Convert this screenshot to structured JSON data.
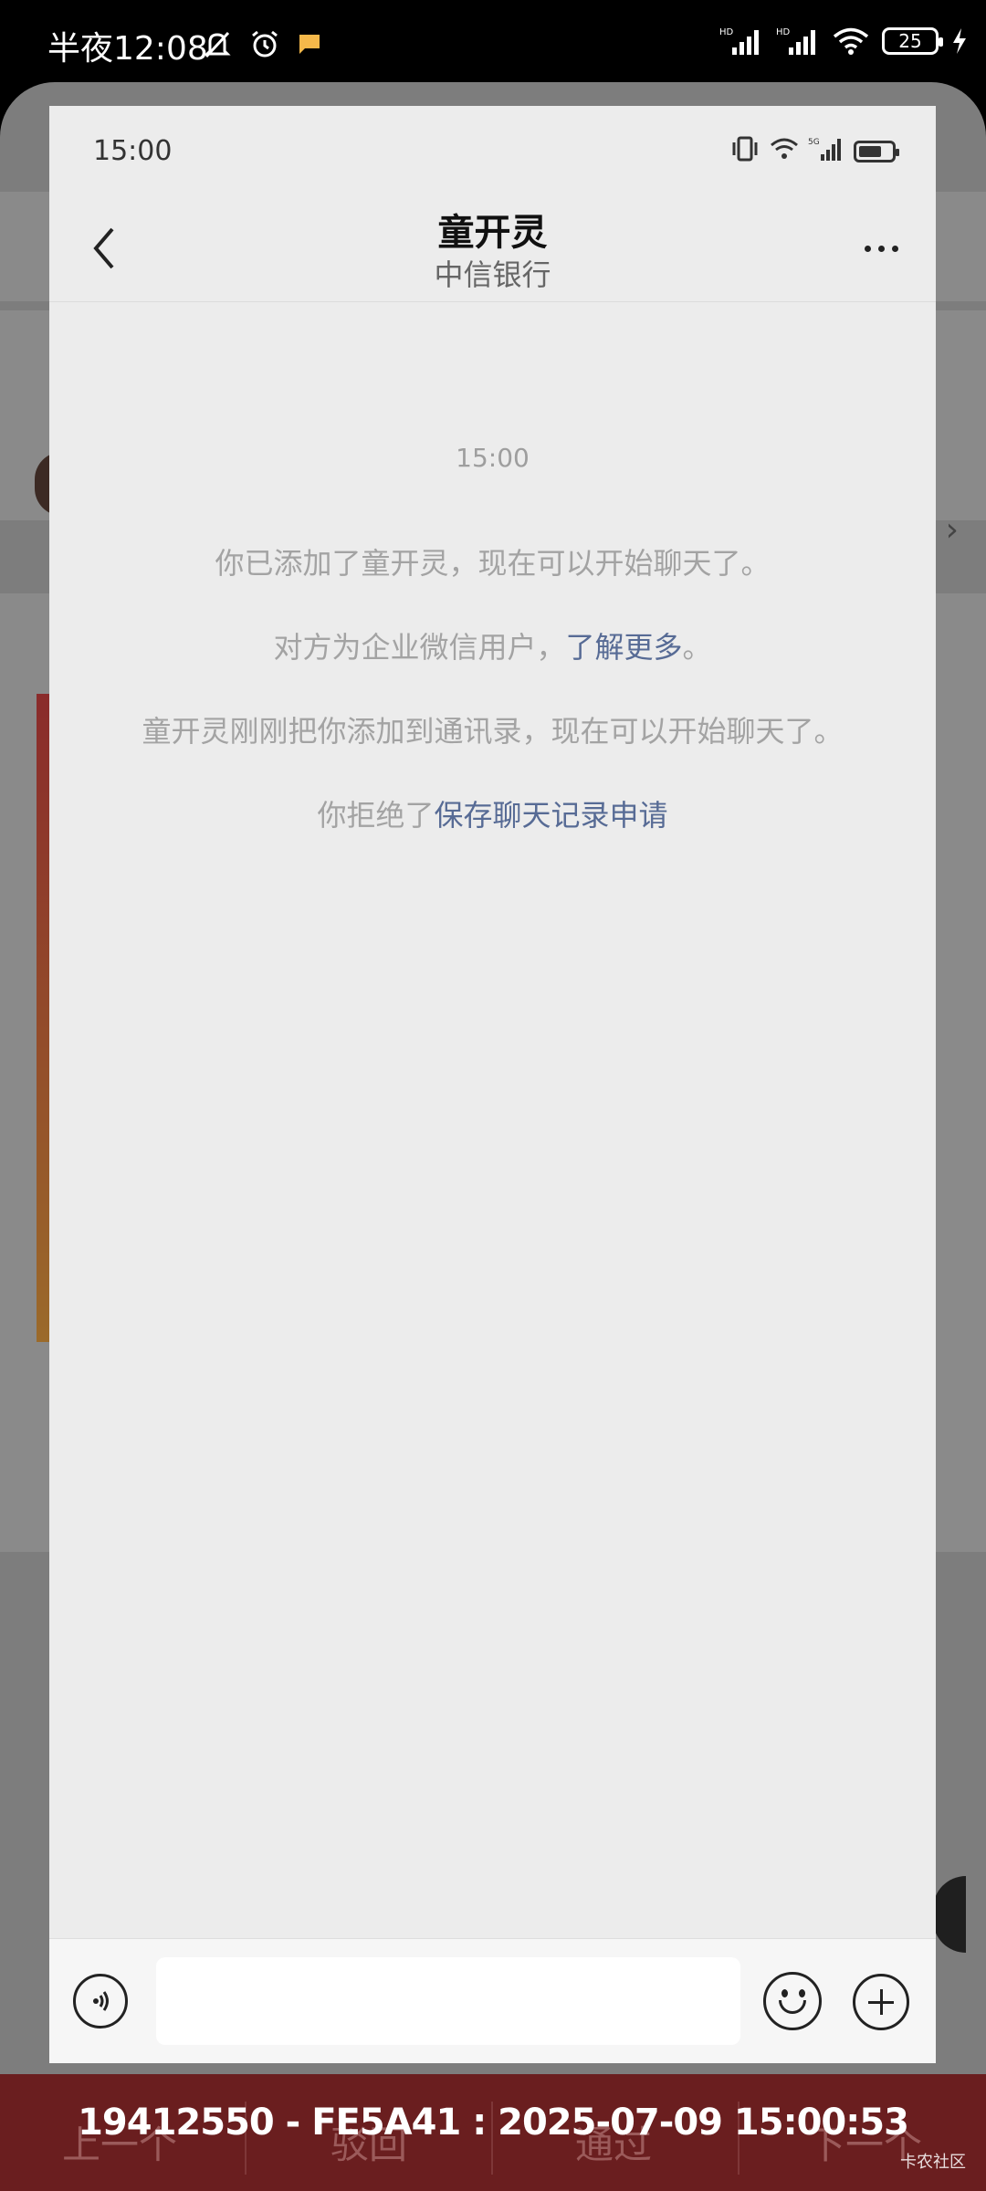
{
  "outer_status": {
    "time": "半夜12:08",
    "battery": "25"
  },
  "chat": {
    "status_time": "15:00",
    "title": "童开灵",
    "subtitle": "中信银行",
    "messages": {
      "time": "15:00",
      "line1": "你已添加了童开灵，现在可以开始聊天了。",
      "line2_prefix": "对方为企业微信用户，",
      "line2_link": "了解更多",
      "line2_suffix": "。",
      "line3": "童开灵刚刚把你添加到通讯录，现在可以开始聊天了。",
      "line4_prefix": "你拒绝了",
      "line4_link": "保存聊天记录申请"
    },
    "input_value": ""
  },
  "review_bar": {
    "prev_label": "上一个",
    "reject_label": "驳回",
    "approve_label": "通过",
    "next_label": "下一个",
    "record_id": "19412550  - FE5A41 : 2025-07-09 15:00:53",
    "watermark": "卡农社区"
  },
  "colors": {
    "link": "#576b95",
    "review_bar_bg": "#6a1e1f"
  }
}
